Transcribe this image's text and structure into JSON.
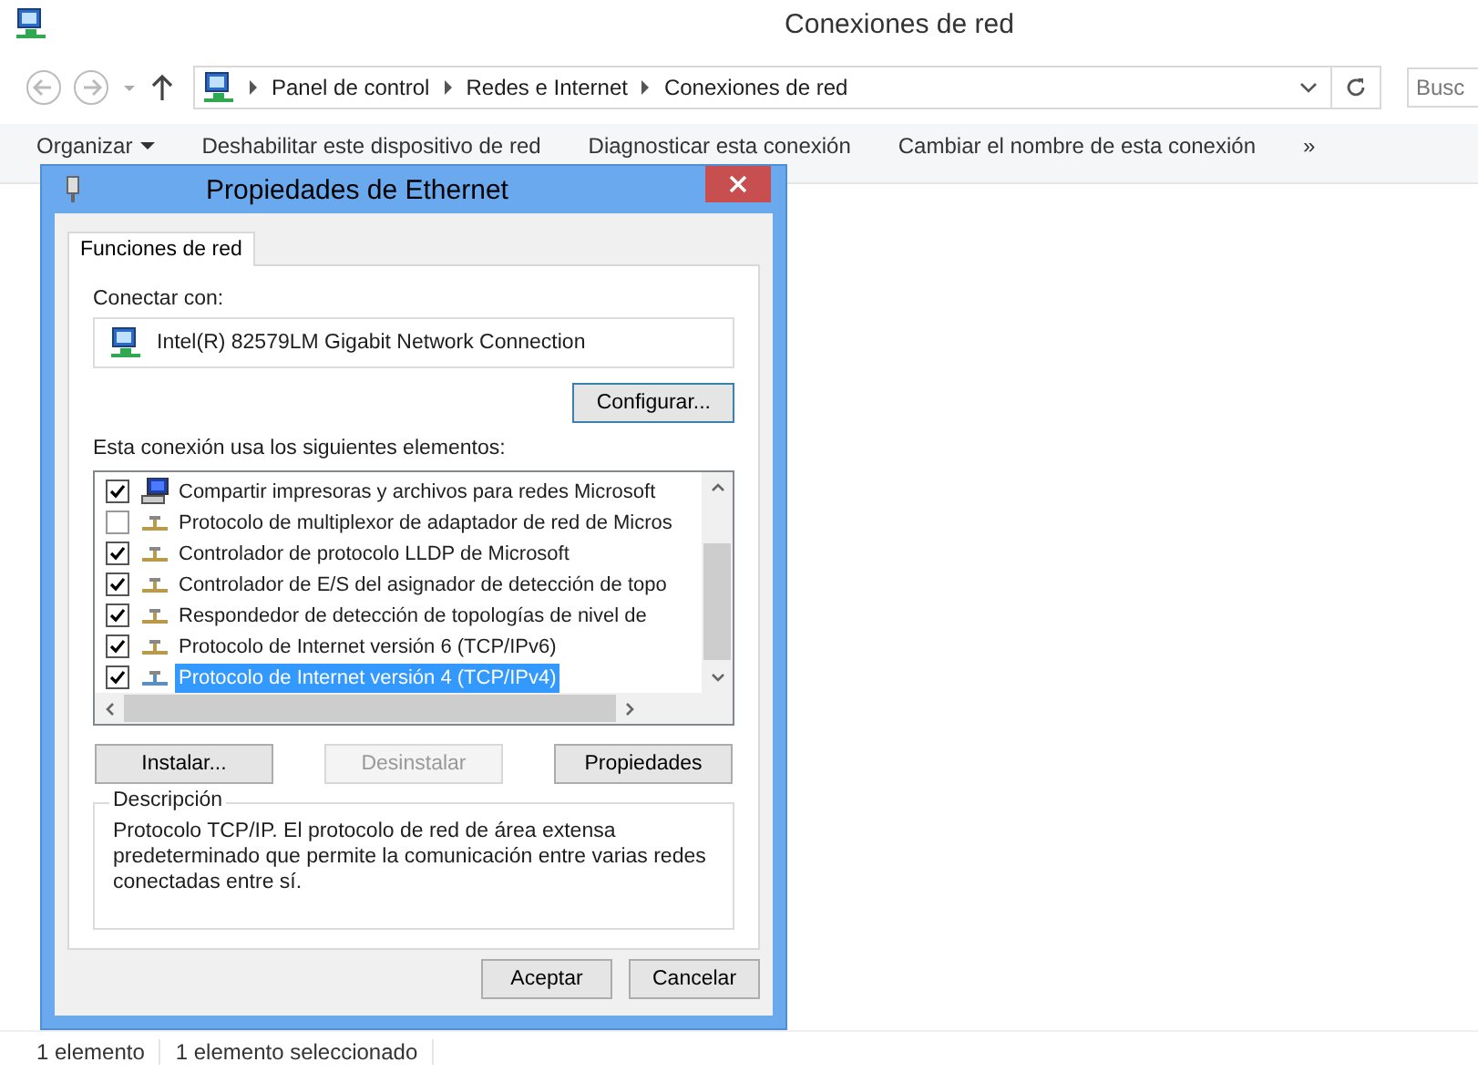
{
  "window": {
    "title": "Conexiones de red"
  },
  "address": {
    "crumbs": [
      "Panel de control",
      "Redes e Internet",
      "Conexiones de red"
    ]
  },
  "search": {
    "placeholder": "Busc"
  },
  "toolbar": [
    {
      "label": "Organizar",
      "kind": "menu"
    },
    {
      "label": "Deshabilitar este dispositivo de red",
      "kind": "command"
    },
    {
      "label": "Diagnosticar esta conexión",
      "kind": "command"
    },
    {
      "label": "Cambiar el nombre de esta conexión",
      "kind": "command"
    },
    {
      "label": "»",
      "kind": "more"
    }
  ],
  "dialog": {
    "title": "Propiedades de Ethernet",
    "tabs": [
      {
        "label": "Funciones de red",
        "selected": true
      }
    ],
    "connect_label": "Conectar con:",
    "adapter": "Intel(R) 82579LM Gigabit Network Connection",
    "configure_button": "Configurar...",
    "components_label": "Esta conexión usa los siguientes elementos:",
    "components": [
      {
        "label": "Compartir impresoras y archivos para redes Microsoft",
        "kind": "service",
        "checked": true,
        "selected": false
      },
      {
        "label": "Protocolo de multiplexor de adaptador de red de Micros",
        "kind": "protocol",
        "checked": false,
        "selected": false
      },
      {
        "label": "Controlador de protocolo LLDP de Microsoft",
        "kind": "protocol",
        "checked": true,
        "selected": false
      },
      {
        "label": "Controlador de E/S del asignador de detección de topo",
        "kind": "protocol",
        "checked": true,
        "selected": false
      },
      {
        "label": "Respondedor de detección de topologías de nivel de",
        "kind": "protocol",
        "checked": true,
        "selected": false
      },
      {
        "label": "Protocolo de Internet versión 6 (TCP/IPv6)",
        "kind": "protocol",
        "checked": true,
        "selected": false
      },
      {
        "label": "Protocolo de Internet versión 4 (TCP/IPv4)",
        "kind": "protocol",
        "checked": true,
        "selected": true
      }
    ],
    "buttons": [
      {
        "label": "Instalar...",
        "disabled": false
      },
      {
        "label": "Desinstalar",
        "disabled": true
      },
      {
        "label": "Propiedades",
        "disabled": false
      }
    ],
    "description": {
      "title": "Descripción",
      "text": "Protocolo TCP/IP. El protocolo de red de área extensa predeterminado que permite la comunicación entre varias redes conectadas entre sí."
    },
    "footer_buttons": [
      "Aceptar",
      "Cancelar"
    ]
  },
  "status_bar": [
    "1 elemento",
    "1 elemento seleccionado"
  ]
}
